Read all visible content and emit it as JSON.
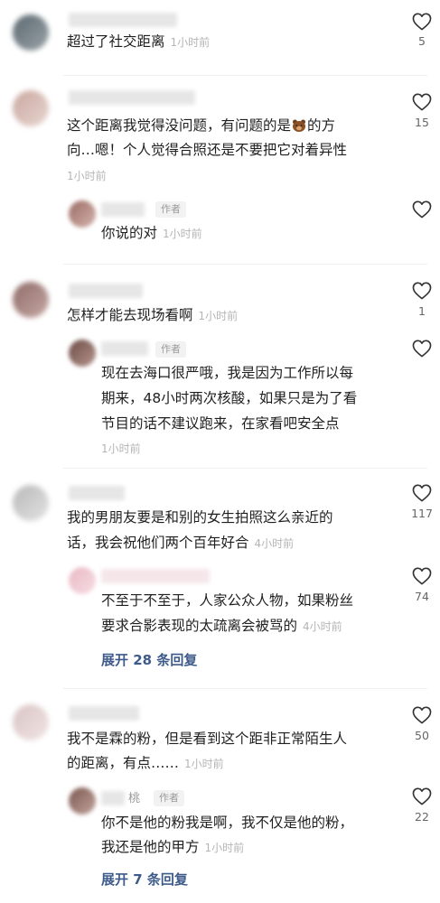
{
  "comments": [
    {
      "text": "超过了社交距离",
      "time": "1小时前",
      "likes": "5"
    },
    {
      "text_line1_a": "这个距离我觉得没问题，有问题的是",
      "emoji": "bear-emoji-icon",
      "text_line1_b": "的方",
      "text_line2": "向…嗯！个人觉得合照还是不要把它对着异性",
      "time": "1小时前",
      "likes": "15",
      "reply": {
        "author_tag": "作者",
        "text": "你说的对",
        "time": "1小时前"
      }
    },
    {
      "text": "怎样才能去现场看啊",
      "time": "1小时前",
      "likes": "1",
      "reply": {
        "author_tag": "作者",
        "line1": "现在去海口很严哦，我是因为工作所以每",
        "line2": "期来，48小时两次核酸，如果只是为了看",
        "line3": "节目的话不建议跑来，在家看吧安全点",
        "time": "1小时前"
      }
    },
    {
      "line1": "我的男朋友要是和别的女生拍照这么亲近的",
      "line2": "话，我会祝他们两个百年好合",
      "time": "4小时前",
      "likes": "117",
      "reply": {
        "line1": "不至于不至于，人家公众人物，如果粉丝",
        "line2": "要求合影表现的太疏离会被骂的",
        "time": "4小时前",
        "likes": "74"
      },
      "expand": "展开 28 条回复"
    },
    {
      "line1": "我不是霖的粉，但是看到这个距非正常陌生人",
      "line2": "的距离，有点……",
      "time": "1小时前",
      "likes": "50",
      "reply": {
        "name": "桃",
        "author_tag": "作者",
        "line1": "你不是他的粉我是啊，我不仅是他的粉，",
        "line2": "我还是他的甲方",
        "time": "1小时前",
        "likes": "22"
      },
      "expand": "展开 7 条回复"
    }
  ],
  "colors": {
    "expand": "#3e5a8a",
    "time": "#b5b5b5",
    "like_count": "#666666"
  }
}
